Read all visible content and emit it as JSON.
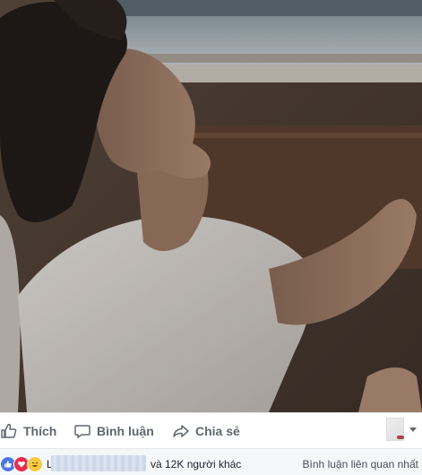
{
  "photo": {
    "alt_subject": "young man in white t-shirt reclining by a train window"
  },
  "actions": {
    "like_label": "Thích",
    "comment_label": "Bình luận",
    "share_label": "Chia sẻ"
  },
  "summary": {
    "first_name_initial": "L",
    "others_text": "và 12K người khác",
    "sort_label": "Bình luận liên quan nhất"
  },
  "colors": {
    "action_text": "#606770",
    "like_blue": "#4a76e8",
    "love_red": "#f0284a",
    "haha_yellow": "#f7c941",
    "summary_bg": "#f6f7f9"
  },
  "icons": {
    "like": "thumbs-up-icon",
    "comment": "speech-bubble-icon",
    "share": "share-arrow-icon",
    "caret": "chevron-down-icon"
  }
}
